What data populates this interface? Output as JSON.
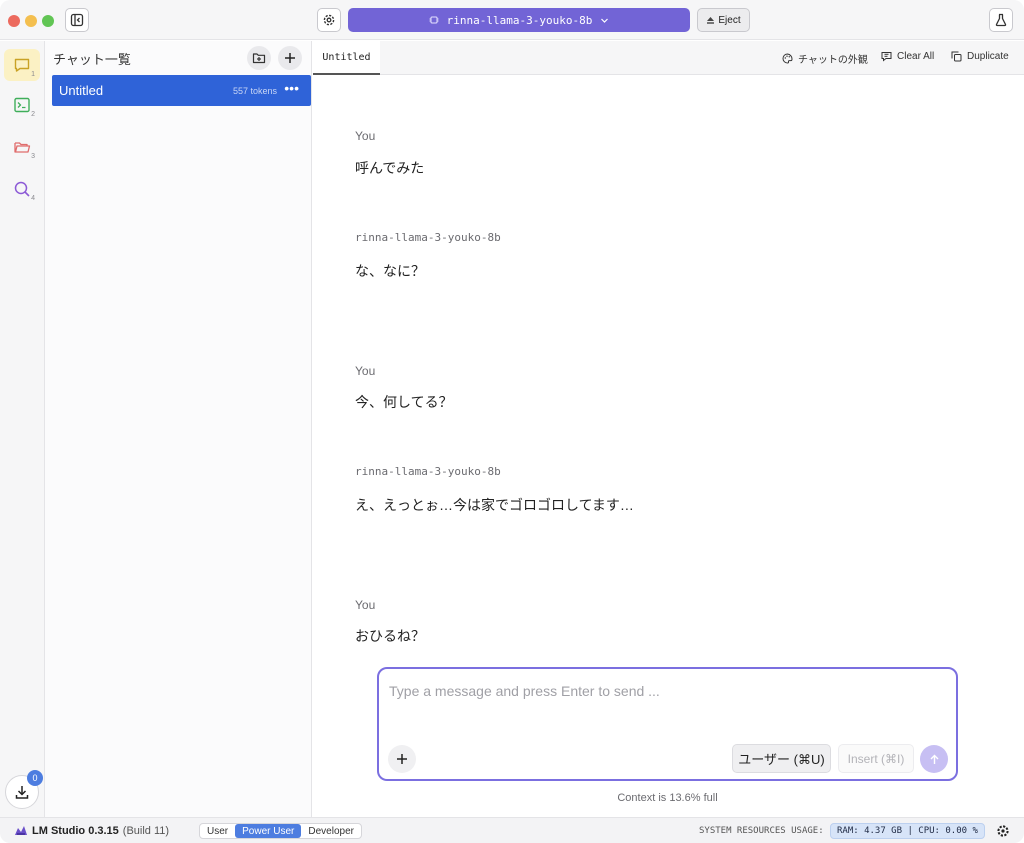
{
  "titlebar": {
    "model_name": "rinna-llama-3-youko-8b",
    "eject_label": "Eject"
  },
  "rail": {
    "items": [
      {
        "name": "chat",
        "number": "1"
      },
      {
        "name": "developer",
        "number": "2"
      },
      {
        "name": "my-models",
        "number": "3"
      },
      {
        "name": "discover",
        "number": "4"
      }
    ],
    "downloads_count": "0"
  },
  "chat_list": {
    "title": "チャット一覧",
    "items": [
      {
        "title": "Untitled",
        "tokens": "557 tokens"
      }
    ]
  },
  "tabbar": {
    "tab_label": "Untitled",
    "appearance_label": "チャットの外観",
    "clear_all_label": "Clear All",
    "duplicate_label": "Duplicate"
  },
  "messages": [
    {
      "sender": "You",
      "text": "呼んでみた"
    },
    {
      "sender": "rinna-llama-3-youko-8b",
      "text": "な、なに？"
    },
    {
      "sender": "You",
      "text": "今、何してる？"
    },
    {
      "sender": "rinna-llama-3-youko-8b",
      "text": "え、えっとぉ…今は家でゴロゴロしてます…"
    },
    {
      "sender": "You",
      "text": "おひるね？"
    }
  ],
  "composer": {
    "placeholder": "Type a message and press Enter to send ...",
    "role_label": "ユーザー (⌘U)",
    "insert_label": "Insert (⌘I)"
  },
  "context_note": "Context is 13.6% full",
  "statusbar": {
    "app_name": "LM Studio 0.3.15",
    "build": "(Build 11)",
    "modes": [
      "User",
      "Power User",
      "Developer"
    ],
    "active_mode": "Power User",
    "resources_label": "SYSTEM RESOURCES USAGE:",
    "resources_value": "RAM: 4.37 GB | CPU: 0.00 %"
  },
  "colors": {
    "accent": "#7264d6",
    "selection": "#2f63d8",
    "active_mode": "#4d7de0"
  }
}
